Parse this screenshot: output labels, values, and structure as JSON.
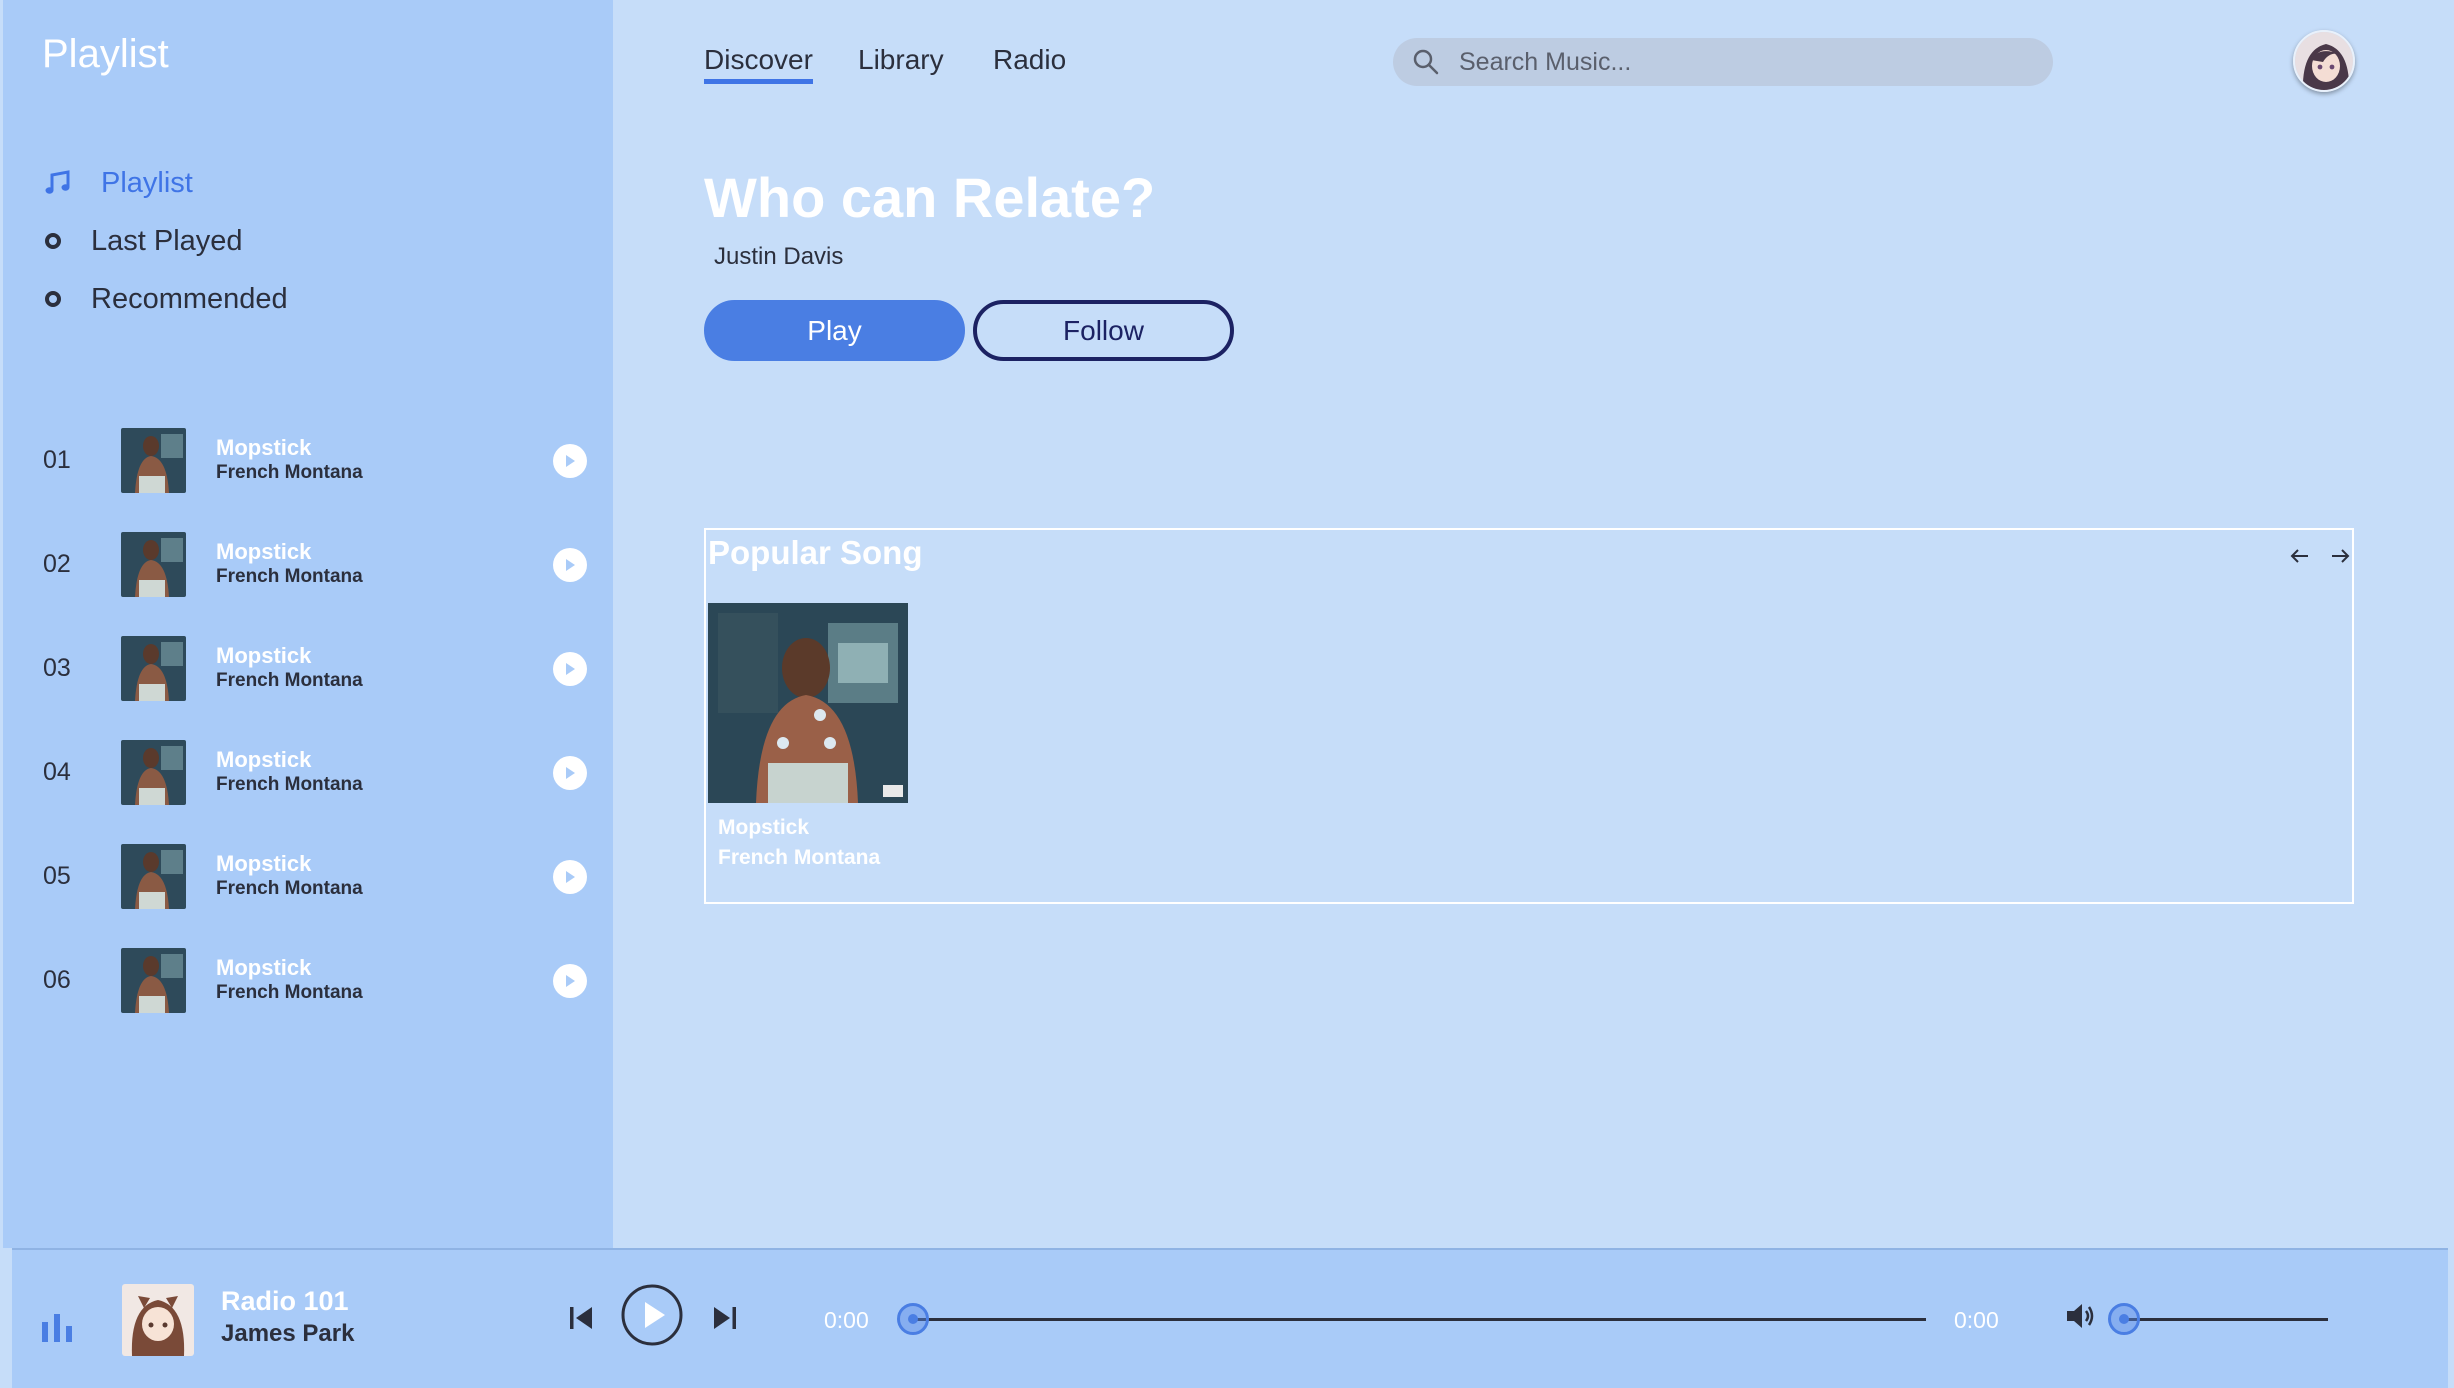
{
  "sidebar": {
    "title": "Playlist",
    "nav": [
      {
        "label": "Playlist",
        "icon": "music-note-icon",
        "active": true
      },
      {
        "label": "Last Played",
        "icon": "circle-icon",
        "active": false
      },
      {
        "label": "Recommended",
        "icon": "circle-icon",
        "active": false
      }
    ],
    "tracks": [
      {
        "num": "01",
        "title": "Mopstick",
        "artist": "French Montana"
      },
      {
        "num": "02",
        "title": "Mopstick",
        "artist": "French Montana"
      },
      {
        "num": "03",
        "title": "Mopstick",
        "artist": "French Montana"
      },
      {
        "num": "04",
        "title": "Mopstick",
        "artist": "French Montana"
      },
      {
        "num": "05",
        "title": "Mopstick",
        "artist": "French Montana"
      },
      {
        "num": "06",
        "title": "Mopstick",
        "artist": "French Montana"
      }
    ]
  },
  "header": {
    "tabs": [
      {
        "label": "Discover",
        "active": true
      },
      {
        "label": "Library",
        "active": false
      },
      {
        "label": "Radio",
        "active": false
      }
    ],
    "search": {
      "placeholder": "Search Music...",
      "value": ""
    }
  },
  "hero": {
    "title": "Who can Relate?",
    "artist": "Justin Davis",
    "play_label": "Play",
    "follow_label": "Follow"
  },
  "popular": {
    "title": "Popular Song",
    "songs": [
      {
        "title": "Mopstick",
        "artist": "French Montana"
      }
    ]
  },
  "player": {
    "station": "Radio 101",
    "artist": "James Park",
    "elapsed": "0:00",
    "duration": "0:00",
    "progress": 0,
    "volume": 0
  },
  "colors": {
    "background": "#c6ddf9",
    "sidebar": "#a9cbf8",
    "accent": "#4a7ee3",
    "follow_border": "#1c2263"
  }
}
